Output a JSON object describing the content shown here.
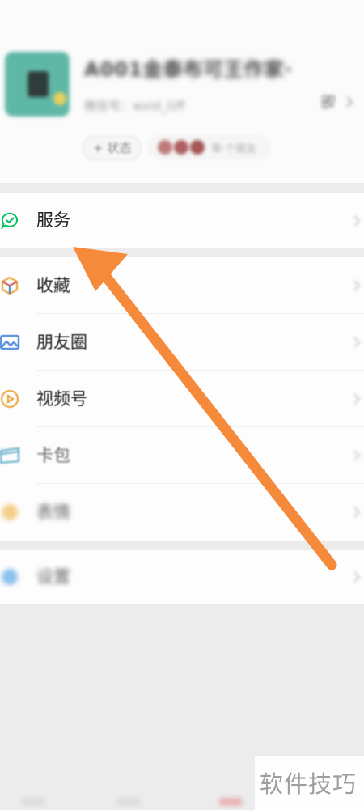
{
  "profile": {
    "nickname": "A001金泰布可王作家·",
    "wxid": "微信号：wxid_Gff",
    "status_button": "+ 状态",
    "friends_text": "等·个朋友"
  },
  "services": {
    "label": "服务",
    "icon": "wechat-pay-check-icon"
  },
  "menu": [
    {
      "label": "收藏",
      "icon": "favorites-cube-icon"
    },
    {
      "label": "朋友圈",
      "icon": "moments-image-icon"
    },
    {
      "label": "视频号",
      "icon": "channels-play-icon"
    },
    {
      "label": "卡包",
      "icon": "card-wallet-icon"
    },
    {
      "label": "表情",
      "icon": "sticker-smile-icon"
    }
  ],
  "settings": {
    "label": "设置",
    "icon": "settings-gear-icon"
  },
  "annotation": {
    "arrow_color": "#f58a3a",
    "points_to": "服务"
  },
  "watermark": {
    "text": "软件技巧"
  },
  "colors": {
    "wechat_green": "#07c160",
    "arrow_orange": "#f58a3a",
    "page_bg": "#ececec"
  }
}
